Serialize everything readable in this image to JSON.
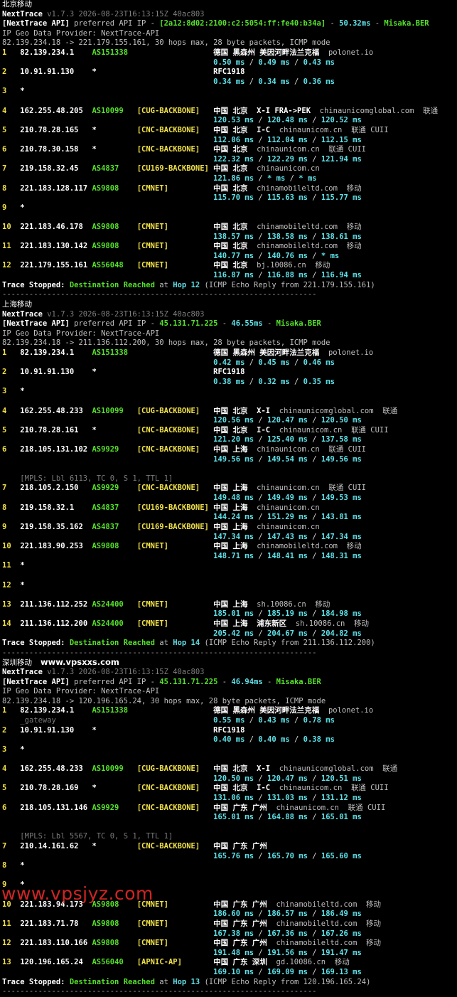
{
  "watermark_small": "www.vpsxxs.com",
  "watermark_large": "www.vpsjyz.com",
  "separator": "----------------------------------------------------------------------",
  "sections": [
    {
      "title": "北京移动",
      "nt_name": "NextTrace",
      "nt_version": "v1.7.3 2026-08-23T16:13:15Z 40ac803",
      "api_prefix": "[NextTrace API]",
      "api_text": "preferred API IP - ",
      "api_ip": "[2a12:8d02:2100:c2:5054:ff:fe40:b34a]",
      "api_dash": " - ",
      "api_ms": "50.32ms",
      "api_dash2": " - ",
      "api_node": "Misaka.BER",
      "geo_line": "IP Geo Data Provider: NextTrace-API",
      "route_line": "82.139.234.18 -> 221.179.155.161, 30 hops max, 28 byte packets, ICMP mode",
      "hops": [
        {
          "num": "1",
          "ip": "82.139.234.1",
          "asn": "AS151338",
          "tag": "",
          "geo": "德国 黑森州 美因河畔法兰克福",
          "host": "polonet.io",
          "isp": "",
          "times": [
            "0.50",
            "0.49",
            "0.43"
          ]
        },
        {
          "num": "2",
          "ip": "10.91.91.130",
          "asn": "*",
          "tag": "",
          "geo": "RFC1918",
          "host": "",
          "isp": "",
          "times": [
            "0.34",
            "0.34",
            "0.36"
          ]
        },
        {
          "num": "3",
          "ip": "*"
        },
        {
          "num": "4",
          "ip": "162.255.48.205",
          "asn": "AS10099",
          "tag": "[CUG-BACKBONE]",
          "geo": "中国 北京  X-I FRA->PEK",
          "host": "chinaunicomglobal.com",
          "isp": "联通",
          "times": [
            "120.53",
            "120.48",
            "120.52"
          ]
        },
        {
          "num": "5",
          "ip": "210.78.28.165",
          "asn": "*",
          "tag": "[CNC-BACKBONE]",
          "geo": "中国 北京  I-C",
          "host": "chinaunicom.cn",
          "isp": "联通 CUII",
          "times": [
            "112.06",
            "112.04",
            "112.15"
          ]
        },
        {
          "num": "6",
          "ip": "210.78.30.158",
          "asn": "*",
          "tag": "[CNC-BACKBONE]",
          "geo": "中国 北京",
          "host": "chinaunicom.cn",
          "isp": "联通 CUII",
          "times": [
            "122.32",
            "122.29",
            "121.94"
          ]
        },
        {
          "num": "7",
          "ip": "219.158.32.45",
          "asn": "AS4837",
          "tag": "[CU169-BACKBONE]",
          "geo": "中国 北京",
          "host": "chinaunicom.cn",
          "isp": "",
          "times": [
            "121.86",
            "*",
            "*"
          ]
        },
        {
          "num": "8",
          "ip": "221.183.128.117",
          "asn": "AS9808",
          "tag": "[CMNET]",
          "geo": "中国 北京",
          "host": "chinamobileltd.com",
          "isp": "移动",
          "times": [
            "115.70",
            "115.63",
            "115.77"
          ]
        },
        {
          "num": "9",
          "ip": "*"
        },
        {
          "num": "10",
          "ip": "221.183.46.178",
          "asn": "AS9808",
          "tag": "[CMNET]",
          "geo": "中国 北京",
          "host": "chinamobileltd.com",
          "isp": "移动",
          "times": [
            "138.57",
            "138.58",
            "138.61"
          ]
        },
        {
          "num": "11",
          "ip": "221.183.130.142",
          "asn": "AS9808",
          "tag": "[CMNET]",
          "geo": "中国 北京",
          "host": "chinamobileltd.com",
          "isp": "移动",
          "times": [
            "140.77",
            "140.76",
            "*"
          ]
        },
        {
          "num": "12",
          "ip": "221.179.155.161",
          "asn": "AS56048",
          "tag": "[CMNET]",
          "geo": "中国 北京",
          "host": "bj.10086.cn",
          "isp": "移动",
          "times": [
            "116.87",
            "116.88",
            "116.94"
          ]
        }
      ],
      "stop_label": "Trace Stopped:",
      "stop_dest": "Destination Reached",
      "stop_at": " at ",
      "stop_hop": "Hop 12",
      "stop_tail": " (ICMP Echo Reply from 221.179.155.161)"
    },
    {
      "title": "上海移动",
      "nt_name": "NextTrace",
      "nt_version": "v1.7.3 2026-08-23T16:13:15Z 40ac803",
      "api_prefix": "[NextTrace API]",
      "api_text": "preferred API IP - ",
      "api_ip": "45.131.71.225",
      "api_dash": " - ",
      "api_ms": "46.55ms",
      "api_dash2": " - ",
      "api_node": "Misaka.BER",
      "geo_line": "IP Geo Data Provider: NextTrace-API",
      "route_line": "82.139.234.18 -> 211.136.112.200, 30 hops max, 28 byte packets, ICMP mode",
      "hops": [
        {
          "num": "1",
          "ip": "82.139.234.1",
          "asn": "AS151338",
          "tag": "",
          "geo": "德国 黑森州 美因河畔法兰克福",
          "host": "polonet.io",
          "isp": "",
          "times": [
            "0.42",
            "0.45",
            "0.46"
          ]
        },
        {
          "num": "2",
          "ip": "10.91.91.130",
          "asn": "*",
          "tag": "",
          "geo": "RFC1918",
          "host": "",
          "isp": "",
          "times": [
            "0.38",
            "0.32",
            "0.35"
          ]
        },
        {
          "num": "3",
          "ip": "*"
        },
        {
          "num": "4",
          "ip": "162.255.48.233",
          "asn": "AS10099",
          "tag": "[CUG-BACKBONE]",
          "geo": "中国 北京  X-I",
          "host": "chinaunicomglobal.com",
          "isp": "联通",
          "times": [
            "120.56",
            "120.47",
            "120.50"
          ]
        },
        {
          "num": "5",
          "ip": "210.78.28.161",
          "asn": "*",
          "tag": "[CNC-BACKBONE]",
          "geo": "中国 北京  I-C",
          "host": "chinaunicom.cn",
          "isp": "联通 CUII",
          "times": [
            "121.20",
            "125.40",
            "137.58"
          ]
        },
        {
          "num": "6",
          "ip": "218.105.131.102",
          "asn": "AS9929",
          "tag": "[CNC-BACKBONE]",
          "geo": "中国 上海",
          "host": "chinaunicom.cn",
          "isp": "联通 CUII",
          "times": [
            "149.56",
            "149.54",
            "149.56"
          ],
          "mpls": "[MPLS: Lbl 6113, TC 0, S 1, TTL 1]"
        },
        {
          "num": "7",
          "ip": "218.105.2.150",
          "asn": "AS9929",
          "tag": "[CNC-BACKBONE]",
          "geo": "中国 上海",
          "host": "chinaunicom.cn",
          "isp": "联通 CUII",
          "times": [
            "149.48",
            "149.49",
            "149.53"
          ]
        },
        {
          "num": "8",
          "ip": "219.158.32.1",
          "asn": "AS4837",
          "tag": "[CU169-BACKBONE]",
          "geo": "中国 上海",
          "host": "chinaunicom.cn",
          "isp": "",
          "times": [
            "144.24",
            "151.29",
            "143.81"
          ]
        },
        {
          "num": "9",
          "ip": "219.158.35.162",
          "asn": "AS4837",
          "tag": "[CU169-BACKBONE]",
          "geo": "中国 上海",
          "host": "chinaunicom.cn",
          "isp": "",
          "times": [
            "147.34",
            "147.43",
            "147.34"
          ]
        },
        {
          "num": "10",
          "ip": "221.183.90.253",
          "asn": "AS9808",
          "tag": "[CMNET]",
          "geo": "中国 上海",
          "host": "chinamobileltd.com",
          "isp": "移动",
          "times": [
            "148.71",
            "148.41",
            "148.31"
          ]
        },
        {
          "num": "11",
          "ip": "*"
        },
        {
          "num": "12",
          "ip": "*"
        },
        {
          "num": "13",
          "ip": "211.136.112.252",
          "asn": "AS24400",
          "tag": "[CMNET]",
          "geo": "中国 上海",
          "host": "sh.10086.cn",
          "isp": "移动",
          "times": [
            "185.01",
            "185.19",
            "184.98"
          ]
        },
        {
          "num": "14",
          "ip": "211.136.112.200",
          "asn": "AS24400",
          "tag": "[CMNET]",
          "geo": "中国 上海  浦东新区",
          "host": "sh.10086.cn",
          "isp": "移动",
          "times": [
            "205.42",
            "204.67",
            "204.82"
          ]
        }
      ],
      "stop_label": "Trace Stopped:",
      "stop_dest": "Destination Reached",
      "stop_at": " at ",
      "stop_hop": "Hop 14",
      "stop_tail": " (ICMP Echo Reply from 211.136.112.200)"
    },
    {
      "title": "深圳移动",
      "nt_name": "NextTrace",
      "nt_version": "v1.7.3 2026-08-23T16:13:15Z 40ac803",
      "api_prefix": "[NextTrace API]",
      "api_text": "preferred API IP - ",
      "api_ip": "45.131.71.225",
      "api_dash": " - ",
      "api_ms": "46.94ms",
      "api_dash2": " - ",
      "api_node": "Misaka.BER",
      "geo_line": "IP Geo Data Provider: NextTrace-API",
      "route_line": "82.139.234.18 -> 120.196.165.24, 30 hops max, 28 byte packets, ICMP mode",
      "hops": [
        {
          "num": "1",
          "ip": "82.139.234.1",
          "asn": "AS151338",
          "tag": "",
          "geo": "德国 黑森州 美因河畔法兰克福",
          "host": "polonet.io",
          "isp": "",
          "times": [
            "0.55",
            "0.43",
            "0.78"
          ],
          "sub": "_gateway"
        },
        {
          "num": "2",
          "ip": "10.91.91.130",
          "asn": "*",
          "tag": "",
          "geo": "RFC1918",
          "host": "",
          "isp": "",
          "times": [
            "0.40",
            "0.40",
            "0.38"
          ]
        },
        {
          "num": "3",
          "ip": "*"
        },
        {
          "num": "4",
          "ip": "162.255.48.233",
          "asn": "AS10099",
          "tag": "[CUG-BACKBONE]",
          "geo": "中国 北京  X-I",
          "host": "chinaunicomglobal.com",
          "isp": "联通",
          "times": [
            "120.50",
            "120.47",
            "120.51"
          ]
        },
        {
          "num": "5",
          "ip": "210.78.28.169",
          "asn": "*",
          "tag": "[CNC-BACKBONE]",
          "geo": "中国 北京  I-C",
          "host": "chinaunicom.cn",
          "isp": "联通 CUII",
          "times": [
            "131.06",
            "131.03",
            "131.12"
          ]
        },
        {
          "num": "6",
          "ip": "218.105.131.146",
          "asn": "AS9929",
          "tag": "[CNC-BACKBONE]",
          "geo": "中国 广东 广州",
          "host": "chinaunicom.cn",
          "isp": "联通 CUII",
          "times": [
            "165.01",
            "164.88",
            "165.01"
          ],
          "mpls": "[MPLS: Lbl 5567, TC 0, S 1, TTL 1]"
        },
        {
          "num": "7",
          "ip": "210.14.161.62",
          "asn": "*",
          "tag": "[CNC-BACKBONE]",
          "geo": "中国 广东 广州",
          "host": "",
          "isp": "",
          "times": [
            "165.76",
            "165.70",
            "165.60"
          ]
        },
        {
          "num": "8",
          "ip": "*"
        },
        {
          "num": "9",
          "ip": "*"
        },
        {
          "num": "10",
          "ip": "221.183.94.173",
          "asn": "AS9808",
          "tag": "[CMNET]",
          "geo": "中国 广东 广州",
          "host": "chinamobileltd.com",
          "isp": "移动",
          "times": [
            "186.60",
            "186.57",
            "186.49"
          ]
        },
        {
          "num": "11",
          "ip": "221.183.71.78",
          "asn": "AS9808",
          "tag": "[CMNET]",
          "geo": "中国 广东 广州",
          "host": "chinamobileltd.com",
          "isp": "移动",
          "times": [
            "167.38",
            "167.36",
            "167.26"
          ]
        },
        {
          "num": "12",
          "ip": "221.183.110.166",
          "asn": "AS9808",
          "tag": "[CMNET]",
          "geo": "中国 广东 广州",
          "host": "chinamobileltd.com",
          "isp": "移动",
          "times": [
            "191.48",
            "191.56",
            "191.47"
          ]
        },
        {
          "num": "13",
          "ip": "120.196.165.24",
          "asn": "AS56040",
          "tag": "[APNIC-AP]",
          "geo": "中国 广东 深圳",
          "host": "gd.10086.cn",
          "isp": "移动",
          "times": [
            "169.10",
            "169.09",
            "169.13"
          ]
        }
      ],
      "stop_label": "Trace Stopped:",
      "stop_dest": "Destination Reached",
      "stop_at": " at ",
      "stop_hop": "Hop 13",
      "stop_tail": " (ICMP Echo Reply from 120.196.165.24)"
    }
  ]
}
